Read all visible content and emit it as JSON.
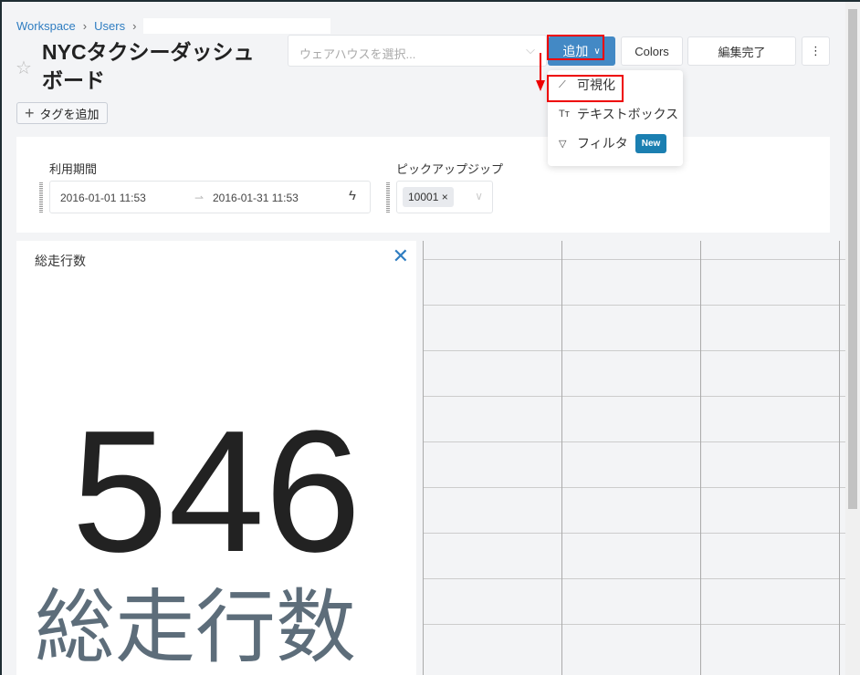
{
  "breadcrumb": {
    "items": [
      "Workspace",
      "Users"
    ]
  },
  "title": "NYCタクシーダッシュボード",
  "add_tag": "タグを追加",
  "warehouse": {
    "placeholder": "ウェアハウスを選択..."
  },
  "toolbar": {
    "add": "追加",
    "colors": "Colors",
    "done": "編集完了",
    "more": "⋮"
  },
  "add_menu": {
    "items": [
      {
        "label": "可視化",
        "icon": "chart-icon"
      },
      {
        "label": "テキストボックス",
        "icon": "text-icon"
      },
      {
        "label": "フィルタ",
        "icon": "filter-icon",
        "badge": "New"
      }
    ]
  },
  "filters": {
    "date_label": "利用期間",
    "date_from": "2016-01-01 11:53",
    "date_to": "2016-01-31 11:53",
    "zip_label": "ピックアップジップ",
    "zip_value": "10001"
  },
  "widget": {
    "title": "総走行数",
    "value": "546",
    "subtitle": "総走行数"
  }
}
